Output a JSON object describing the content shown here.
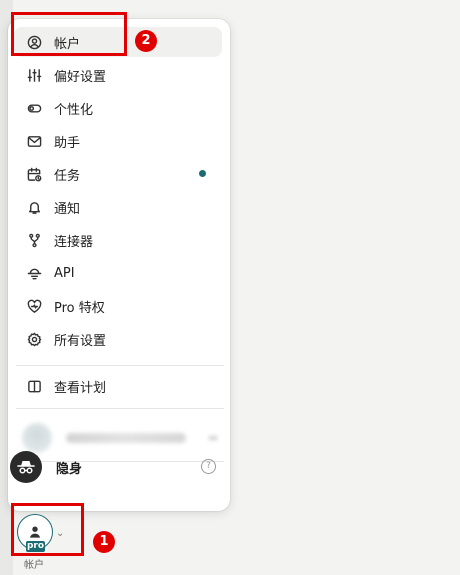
{
  "menu": {
    "items": [
      {
        "label": "帐户",
        "icon": "user-circle-icon"
      },
      {
        "label": "偏好设置",
        "icon": "sliders-icon"
      },
      {
        "label": "个性化",
        "icon": "toggle-icon"
      },
      {
        "label": "助手",
        "icon": "mail-icon"
      },
      {
        "label": "任务",
        "icon": "calendar-clock-icon"
      },
      {
        "label": "通知",
        "icon": "bell-icon"
      },
      {
        "label": "连接器",
        "icon": "fork-icon"
      },
      {
        "label": "API",
        "icon": "api-icon"
      },
      {
        "label": "Pro 特权",
        "icon": "heart-badge-icon"
      },
      {
        "label": "所有设置",
        "icon": "gear-icon"
      }
    ],
    "view_plan": {
      "label": "查看计划",
      "icon": "panel-icon"
    },
    "incognito": {
      "label": "隐身",
      "help": "?"
    }
  },
  "profile": {
    "badge": "pro",
    "label": "帐户"
  },
  "annotations": {
    "one": "1",
    "two": "2"
  },
  "colors": {
    "accent": "#1b6b72",
    "highlight": "#e00000"
  }
}
